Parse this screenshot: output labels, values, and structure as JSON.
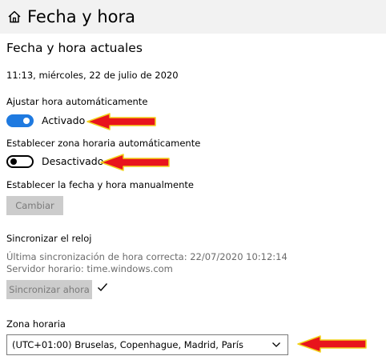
{
  "header": {
    "title": "Fecha y hora",
    "home_icon": "home-icon"
  },
  "current": {
    "section_title": "Fecha y hora actuales",
    "datetime": "11:13, miércoles, 22 de julio de 2020"
  },
  "auto_time": {
    "label": "Ajustar hora automáticamente",
    "state": "Activado",
    "on": true
  },
  "auto_timezone": {
    "label": "Establecer zona horaria automáticamente",
    "state": "Desactivado",
    "on": false
  },
  "manual": {
    "label": "Establecer la fecha y hora manualmente",
    "button_label": "Cambiar"
  },
  "sync": {
    "title": "Sincronizar el reloj",
    "last_sync": "Última sincronización de hora correcta: 22/07/2020 10:12:14",
    "server": "Servidor horario: time.windows.com",
    "button_label": "Sincronizar ahora",
    "status_icon": "checkmark-icon"
  },
  "timezone": {
    "label": "Zona horaria",
    "selected": "(UTC+01:00) Bruselas, Copenhague, Madrid, París"
  },
  "colors": {
    "accent": "#1f7ae0",
    "arrow_fill": "#e8141c",
    "arrow_outline": "#f2d21b",
    "header_bg": "#f2f2f2",
    "button_bg": "#cccccc"
  }
}
